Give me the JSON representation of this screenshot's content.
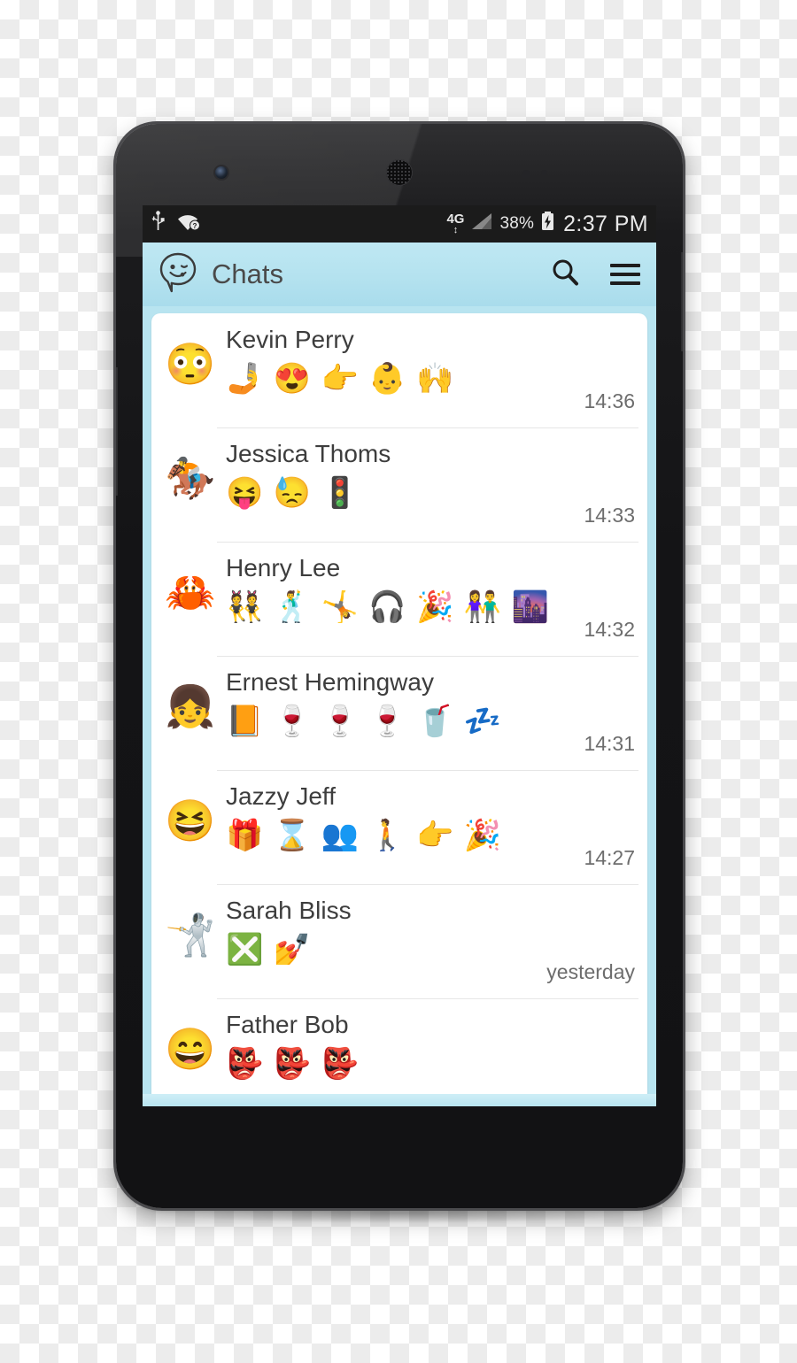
{
  "statusbar": {
    "usb_icon": "usb-icon",
    "wifi_icon": "wifi-question-icon",
    "network_type": "4G",
    "network_arrows": "↕",
    "signal_icon": "signal-triangle-icon",
    "battery_percent": "38%",
    "battery_icon": "battery-charging-icon",
    "clock": "2:37 PM"
  },
  "appbar": {
    "logo_icon": "winking-smiley-bubble-icon",
    "title": "Chats",
    "search_icon": "search-icon",
    "menu_icon": "hamburger-menu-icon"
  },
  "chats": [
    {
      "name": "Kevin Perry",
      "avatar": "😳",
      "avatar_name": "flushed-face-avatar",
      "message": "🤳 😍 👉 👶 🙌",
      "time": "14:36"
    },
    {
      "name": "Jessica Thoms",
      "avatar": "🏇",
      "avatar_name": "horse-racing-avatar",
      "message": "😝 😓 🚦",
      "time": "14:33"
    },
    {
      "name": "Henry Lee",
      "avatar": "🦀",
      "avatar_name": "crab-avatar",
      "message": "👯 🕺 🤸 🎧 🎉 👫 🌆",
      "time": "14:32"
    },
    {
      "name": "Ernest Hemingway",
      "avatar": "👧",
      "avatar_name": "red-haired-girl-avatar",
      "message": "📙 🍷 🍷 🍷 🥤 💤",
      "time": "14:31"
    },
    {
      "name": "Jazzy Jeff",
      "avatar": "😆",
      "avatar_name": "grinning-squinting-face-avatar",
      "message": "🎁 ⌛ 👥 🚶 👉 🎉",
      "time": "14:27"
    },
    {
      "name": "Sarah Bliss",
      "avatar": "🤺",
      "avatar_name": "samurai-fencer-avatar",
      "message": "❎ 💅",
      "time": "yesterday"
    },
    {
      "name": "Father Bob",
      "avatar": "😄",
      "avatar_name": "smiling-face-avatar",
      "message": "👺 👺 👺",
      "time": ""
    }
  ],
  "colors": {
    "appbar": "#b4e2ef",
    "screen_bg": "#b8e4f0",
    "list_bg": "#ffffff",
    "name_text": "#3d3d3d",
    "time_text": "#6d6d6d",
    "statusbar": "#1b1b1b"
  },
  "device": {
    "name": "smartphone-mockup",
    "front_camera": "front-camera",
    "earpiece": "earpiece-speaker",
    "volume_button": "volume-rocker-button",
    "power_button": "power-button"
  }
}
